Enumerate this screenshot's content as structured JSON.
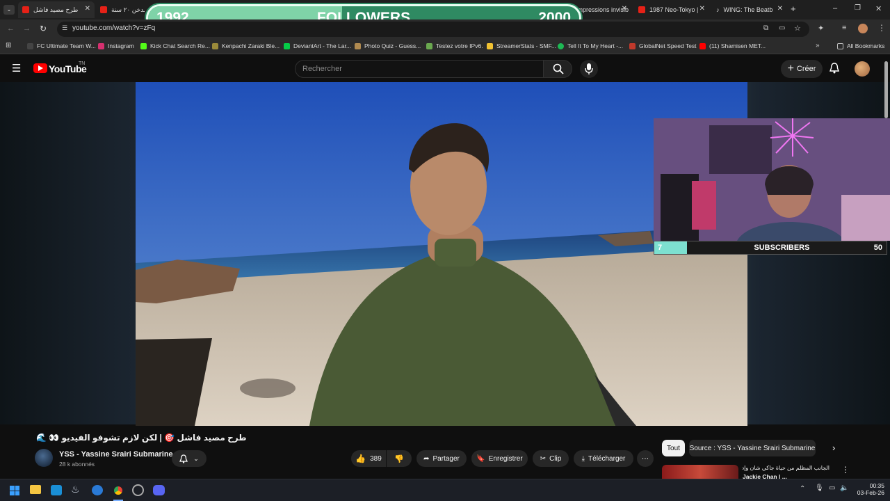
{
  "browser": {
    "tabs": [
      {
        "label": "طرح مصيد فاشل",
        "active": true
      },
      {
        "label": "مدخن ٢٠ سنة"
      },
      {
        "label": "Impressions invisib"
      },
      {
        "label": "1987 Neo-Tokyo |"
      },
      {
        "label": "WING: The Beatb"
      }
    ],
    "url": "youtube.com/watch?v=zFq",
    "bookmarks": [
      "FC Ultimate Team W...",
      "Instagram",
      "Kick Chat Search Re...",
      "Kenpachi Zaraki Ble...",
      "DeviantArt - The Lar...",
      "Photo Quiz - Guess...",
      "Testez votre IPv6.",
      "StreamerStats - SMF...",
      "Tell It To My Heart -...",
      "GlobalNet Speed Test",
      "(11) Shamisen MET..."
    ],
    "all_bookmarks_label": "All Bookmarks"
  },
  "overlay_followers": {
    "left": "1992",
    "label": "FOLLOWERS",
    "right": "2000",
    "progress": 0.45
  },
  "overlay_subscribers": {
    "left": "7",
    "label": "SUBSCRIBERS",
    "right": "50",
    "progress": 0.14
  },
  "youtube": {
    "logo": "YouTube",
    "logo_country": "TN",
    "search_placeholder": "Rechercher",
    "create_label": "Créer",
    "video_title": "طرح مصيد فاشل 🎯 | لكن لازم تشوفو الفيديو 👀 🌊",
    "channel_name": "YSS - Yassine Srairi Submarine",
    "subscribers": "28 k abonnés",
    "likes": "389",
    "share": "Partager",
    "save": "Enregistrer",
    "clip": "Clip",
    "download": "Télécharger",
    "chip_all": "Tout",
    "chip_source": "Source : YSS - Yassine Srairi Submarine",
    "rec_title_line1": "الجانب المظلم من حياة جاكي شان وإدمان",
    "rec_title_line2": "Jackie Chan | ..."
  },
  "taskbar": {
    "time": "00:35",
    "date": "03-Feb-26"
  },
  "colors": {
    "followers_green": "#7fd3a8",
    "followers_bg": "#2f8a62",
    "subs_accent": "#7de0d0",
    "yt_red": "#ff0000"
  }
}
